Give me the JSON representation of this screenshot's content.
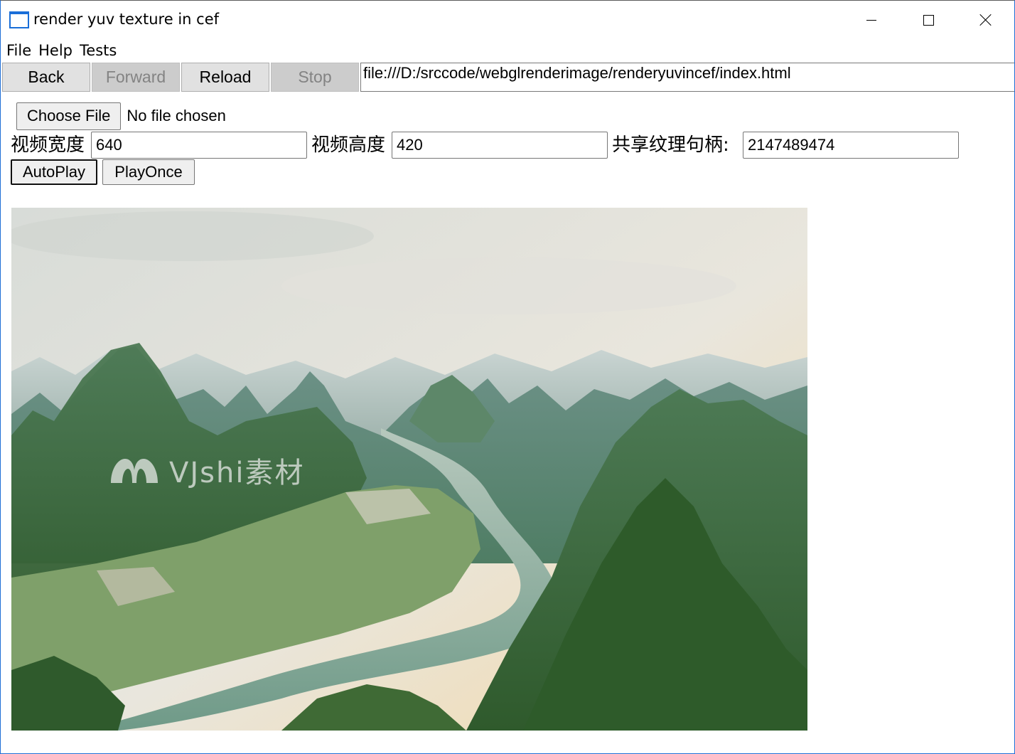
{
  "window": {
    "title": "render yuv texture in cef"
  },
  "menu": {
    "items": [
      "File",
      "Help",
      "Tests"
    ]
  },
  "toolbar": {
    "back_label": "Back",
    "forward_label": "Forward",
    "reload_label": "Reload",
    "stop_label": "Stop",
    "url": "file:///D:/srccode/webglrenderimage/renderyuvincef/index.html"
  },
  "page": {
    "choose_file_label": "Choose File",
    "file_status": "No file chosen",
    "width_label": "视频宽度",
    "width_value": "640",
    "height_label": "视频高度",
    "height_value": "420",
    "handle_label": "共享纹理句柄:",
    "handle_value": "2147489474",
    "autoplay_label": "AutoPlay",
    "playonce_label": "PlayOnce"
  },
  "video": {
    "watermark_text": "VJshi素材"
  }
}
